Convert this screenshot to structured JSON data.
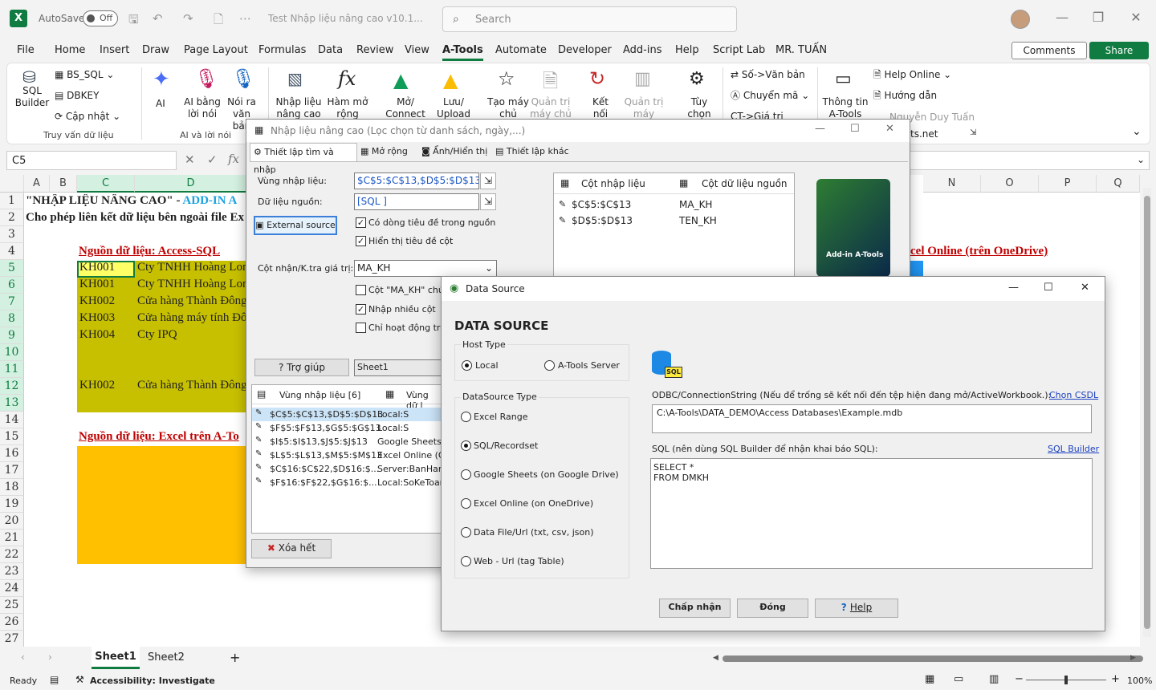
{
  "titlebar": {
    "autosave": "AutoSave",
    "toggle": "Off",
    "doc_title": "Test Nhập liệu nâng cao v10.1...",
    "search": "Search"
  },
  "menu": [
    "File",
    "Home",
    "Insert",
    "Draw",
    "Page Layout",
    "Formulas",
    "Data",
    "Review",
    "View",
    "A-Tools",
    "Automate",
    "Developer",
    "Add-ins",
    "Help",
    "Script Lab",
    "MR. TUẤN"
  ],
  "comments": "Comments",
  "share": "Share",
  "ribbon": {
    "sql_builder": "SQL Builder",
    "bs_sql": "BS_SQL",
    "dbkey": "DBKEY",
    "cap_nhat": "Cập nhật",
    "grp1": "Truy vấn dữ liệu",
    "ai": "AI",
    "ai_bang_loi_noi": "AI bằng lời nói",
    "noi_ra_van_ban": "Nói ra văn bản",
    "grp2": "AI và lời nói",
    "nhap_lieu": "Nhập liệu nâng cao",
    "ham_mo_rong": "Hàm mở rộng",
    "connect": "Mở/ Connect",
    "upload": "Lưu/ Upload",
    "tao_may_chu": "Tạo máy chủ",
    "quan_tri_may_chu": "Quản trị máy chủ",
    "ket_noi": "Kết nối",
    "quan_tri_may_khach": "Quản trị máy khách",
    "tuy_chon": "Tùy chọn",
    "so_van_ban": "Số->Văn bản",
    "chuyen_ma": "Chuyển mã",
    "ct_gia_tri": "CT->Giá trị",
    "thong_tin": "Thông tin A-Tools",
    "help_online": "Help Online",
    "huong_dan": "Hướng dẫn",
    "author": "Nguyễn Duy Tuấn",
    "site": "ts.net"
  },
  "namebox": "C5",
  "fx": "fx",
  "columns": [
    "A",
    "B",
    "C",
    "D",
    "N",
    "O",
    "P",
    "Q"
  ],
  "rows": [
    "1",
    "2",
    "3",
    "4",
    "5",
    "6",
    "7",
    "8",
    "9",
    "10",
    "11",
    "12",
    "13",
    "14",
    "15",
    "16",
    "17",
    "18",
    "19",
    "20",
    "21",
    "22",
    "23",
    "24",
    "25",
    "26",
    "27"
  ],
  "sheet": {
    "r1a": "\"NHẬP LIỆU NÂNG CAO\" - ",
    "r1b": "ADD-IN A",
    "r2": "Cho phép liên kết dữ liệu bên ngoài file Ex",
    "r4": "Nguồn dữ liệu: Access-SQL",
    "r4_right": "cel Online (trên OneDrive)",
    "data": [
      [
        "KH001",
        "Cty TNHH Hoàng Lon"
      ],
      [
        "KH001",
        "Cty TNHH Hoàng Lon"
      ],
      [
        "KH002",
        "Cửa hàng Thành Đông"
      ],
      [
        "KH003",
        "Cửa hàng máy tính Đô"
      ],
      [
        "KH004",
        "Cty IPQ"
      ],
      [
        "",
        ""
      ],
      [
        "",
        ""
      ],
      [
        "KH002",
        "Cửa hàng Thành Đông"
      ]
    ],
    "r15": "Nguồn dữ liệu: Excel trên A-To"
  },
  "tabs": {
    "sheet1": "Sheet1",
    "sheet2": "Sheet2"
  },
  "status": {
    "ready": "Ready",
    "accessibility": "Accessibility: Investigate",
    "zoom": "100%"
  },
  "dlg1": {
    "title": "Nhập liệu nâng cao (Lọc chọn từ danh sách, ngày,...)",
    "tabs": [
      "Thiết lập tìm và nhập",
      "Mở rộng",
      "Ẩnh/Hiển thị",
      "Thiết lập khác"
    ],
    "vung_label": "Vùng nhập liệu:",
    "vung_value": "$C$5:$C$13,$D$5:$D$13",
    "nguon_label": "Dữ liệu nguồn:",
    "nguon_value": "[SQL ]",
    "external": "External source",
    "chk_header": "Có dòng tiêu đề trong nguồn",
    "chk_show": "Hiển thị tiêu đề cột",
    "cot_label": "Cột nhận/K.tra giá trị:",
    "cot_value": "MA_KH",
    "chk_cot": "Cột \"MA_KH\" chứa",
    "chk_multi": "Nhập nhiều cột",
    "chk_active": "Chỉ hoạt động trên",
    "map_h1": "Cột nhập liệu",
    "map_h2": "Cột dữ liệu nguồn",
    "map": [
      [
        "$C$5:$C$13",
        "MA_KH"
      ],
      [
        "$D$5:$D$13",
        "TEN_KH"
      ]
    ],
    "help": "Trợ giúp",
    "sheet_sel": "Sheet1",
    "list_h1": "Vùng nhập liệu [6]",
    "list_h2": "Vùng dữ l",
    "list": [
      [
        "$C$5:$C$13,$D$5:$D$13",
        "Local:S"
      ],
      [
        "$F$5:$F$13,$G$5:$G$13",
        "Local:S"
      ],
      [
        "$I$5:$I$13,$J$5:$J$13",
        "Google Sheets (G"
      ],
      [
        "$L$5:$L$13,$M$5:$M$13",
        "Excel Online (O"
      ],
      [
        "$C$16:$C$22,$D$16:$...",
        "Server:BanHang"
      ],
      [
        "$F$16:$F$22,$G$16:$...",
        "Local:SoKeToanS"
      ]
    ],
    "clear": "Xóa hết",
    "box_title": "Add-in A-Tools"
  },
  "dlg2": {
    "title": "Data Source",
    "heading": "DATA SOURCE",
    "host_type": "Host Type",
    "local": "Local",
    "server": "A-Tools Server",
    "ds_type": "DataSource  Type",
    "options": [
      "Excel Range",
      "SQL/Recordset",
      "Google Sheets (on Google Drive)",
      "Excel Online (on OneDrive)",
      "Data File/Url (txt, csv, json)",
      "Web - Url (tag Table)"
    ],
    "odbc_label": "ODBC/ConnectionString (Nếu để trống sẽ kết nối đến tệp hiện đang mở/ActiveWorkbook.):",
    "choose": "Chọn CSDL",
    "odbc_value": "C:\\A-Tools\\DATA_DEMO\\Access Databases\\Example.mdb",
    "sql_label": "SQL (nên dùng SQL Builder để nhận khai báo SQL):",
    "sql_builder": "SQL Builder",
    "sql1": "SELECT *",
    "sql2": "FROM DMKH",
    "ok": "Chấp nhận",
    "close": "Đóng",
    "help": "Help",
    "sql_icon": "SQL"
  }
}
